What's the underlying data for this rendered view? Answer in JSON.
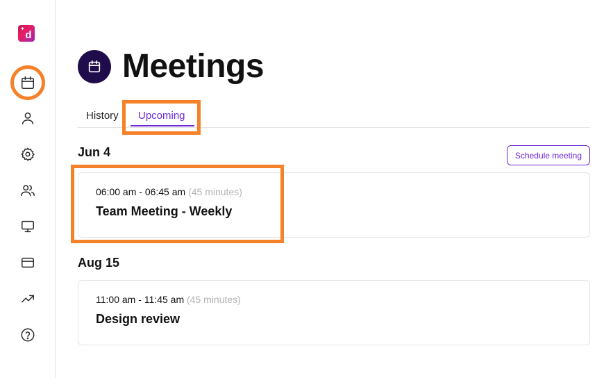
{
  "app": {
    "logo_glyph": "d",
    "logo_spark": "✦"
  },
  "sidebar": {
    "items": [
      {
        "name": "calendar",
        "icon": "calendar-icon",
        "active": true
      },
      {
        "name": "profile",
        "icon": "user-icon"
      },
      {
        "name": "settings",
        "icon": "gear-icon"
      },
      {
        "name": "team",
        "icon": "users-icon"
      },
      {
        "name": "display",
        "icon": "monitor-icon"
      },
      {
        "name": "billing",
        "icon": "credit-card-icon"
      },
      {
        "name": "analytics",
        "icon": "trending-up-icon"
      },
      {
        "name": "help",
        "icon": "help-circle-icon"
      }
    ]
  },
  "header": {
    "title": "Meetings",
    "icon": "calendar-icon"
  },
  "tabs": [
    {
      "label": "History",
      "active": false
    },
    {
      "label": "Upcoming",
      "active": true
    }
  ],
  "actions": {
    "schedule_label": "Schedule meeting"
  },
  "groups": [
    {
      "date": "Jun 4",
      "meetings": [
        {
          "time": "06:00 am - 06:45 am",
          "duration": "(45 minutes)",
          "title": "Team Meeting - Weekly"
        }
      ]
    },
    {
      "date": "Aug 15",
      "meetings": [
        {
          "time": "11:00 am - 11:45 am",
          "duration": "(45 minutes)",
          "title": "Design review"
        }
      ]
    }
  ],
  "colors": {
    "accent": "#6d28d9",
    "highlight": "#f5822a",
    "title_badge": "#1f0c4a",
    "muted": "#b3b3b3"
  }
}
